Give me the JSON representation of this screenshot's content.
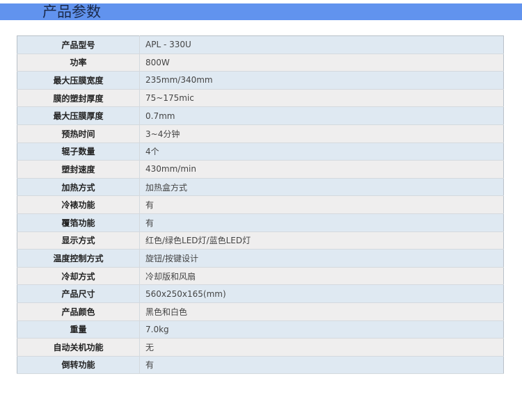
{
  "header": {
    "title": "产品参数"
  },
  "specs": [
    {
      "label": "产品型号",
      "value": "APL - 330U"
    },
    {
      "label": "功率",
      "value": "800W"
    },
    {
      "label": "最大压膜宽度",
      "value": "235mm/340mm"
    },
    {
      "label": "膜的塑封厚度",
      "value": "75~175mic"
    },
    {
      "label": "最大压膜厚度",
      "value": "0.7mm"
    },
    {
      "label": "预热时间",
      "value": "3~4分钟"
    },
    {
      "label": "辊子数量",
      "value": "4个"
    },
    {
      "label": "塑封速度",
      "value": "430mm/min"
    },
    {
      "label": "加热方式",
      "value": "加热盒方式"
    },
    {
      "label": "冷裱功能",
      "value": "有"
    },
    {
      "label": "覆箔功能",
      "value": "有"
    },
    {
      "label": "显示方式",
      "value": "红色/绿色LED灯/蓝色LED灯"
    },
    {
      "label": "温度控制方式",
      "value": "旋钮/按键设计"
    },
    {
      "label": "冷却方式",
      "value": "冷却版和风扇"
    },
    {
      "label": "产品尺寸",
      "value": "560x250x165(mm)"
    },
    {
      "label": "产品颜色",
      "value": "黑色和白色"
    },
    {
      "label": "重量",
      "value": "7.0kg"
    },
    {
      "label": "自动关机功能",
      "value": "无"
    },
    {
      "label": "倒转功能",
      "value": "有"
    }
  ]
}
